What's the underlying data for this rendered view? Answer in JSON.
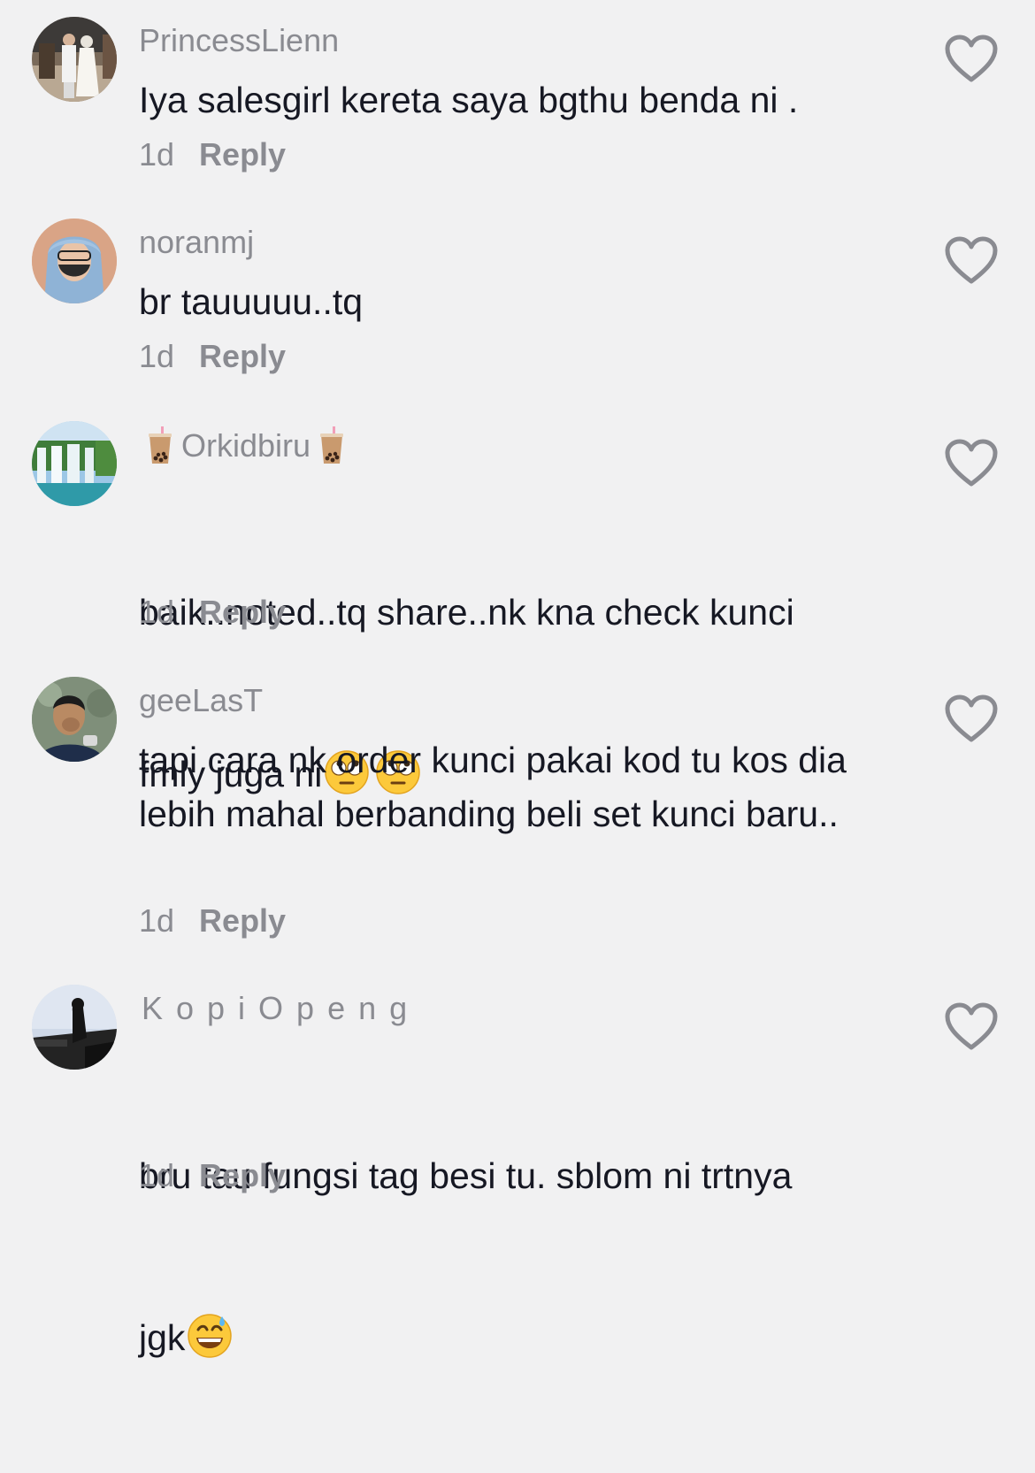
{
  "comments": [
    {
      "username": "PrincessLienn",
      "text": "Iya salesgirl kereta saya bgthu benda ni .",
      "time": "1d",
      "reply_label": "Reply"
    },
    {
      "username": "noranmj",
      "text": "br tauuuuu..tq",
      "time": "1d",
      "reply_label": "Reply"
    },
    {
      "username": "Orkidbiru",
      "username_decoration": "bubble-tea-icon",
      "text_line1": "baik..noted..tq share..nk kna check kunci",
      "text_line2": "fmly juga ni",
      "text_emojis": [
        "face-with-rolling-eyes-emoji",
        "face-with-rolling-eyes-emoji"
      ],
      "time": "1d",
      "reply_label": "Reply"
    },
    {
      "username": "geeLasT",
      "text": "tapi cara nk order kunci pakai kod tu kos dia lebih mahal berbanding beli set kunci baru..",
      "time": "1d",
      "reply_label": "Reply"
    },
    {
      "username": "KopiOpeng",
      "text_line1": "bru tau fungsi tag besi tu. sblom ni trtnya",
      "text_line2": "jgk",
      "text_emojis": [
        "grinning-face-with-sweat-emoji"
      ],
      "time": "1d",
      "reply_label": "Reply"
    }
  ],
  "colors": {
    "background": "#f1f1f2",
    "primary_text": "#161823",
    "secondary_text": "#8a8b91"
  },
  "icons": {
    "like": "heart-outline-icon"
  }
}
